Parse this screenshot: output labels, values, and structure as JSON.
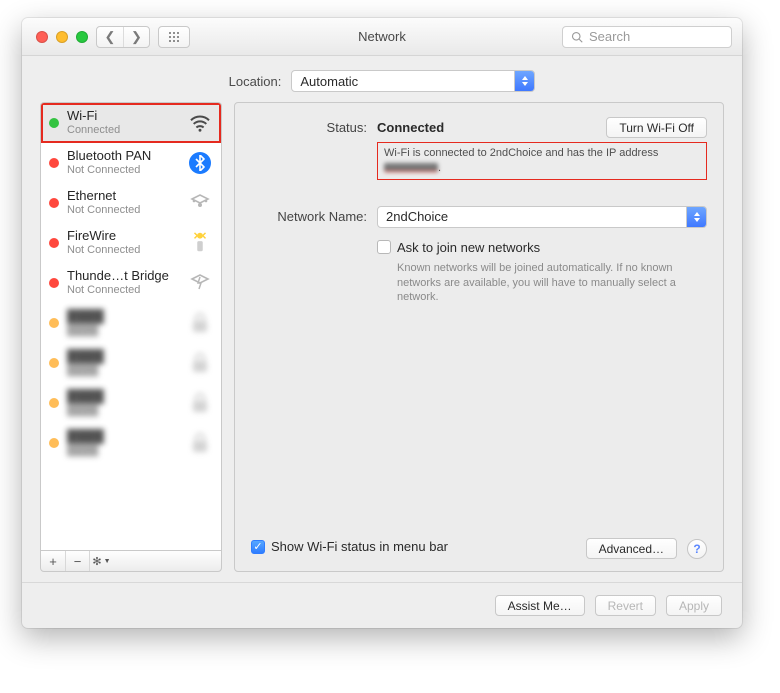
{
  "window": {
    "title": "Network",
    "search_placeholder": "Search"
  },
  "location": {
    "label": "Location:",
    "value": "Automatic"
  },
  "services": [
    {
      "name": "Wi-Fi",
      "sub": "Connected",
      "dot": "green",
      "icon": "wifi",
      "selected": true,
      "highlight": true
    },
    {
      "name": "Bluetooth PAN",
      "sub": "Not Connected",
      "dot": "red",
      "icon": "bluetooth"
    },
    {
      "name": "Ethernet",
      "sub": "Not Connected",
      "dot": "red",
      "icon": "ethernet"
    },
    {
      "name": "FireWire",
      "sub": "Not Connected",
      "dot": "red",
      "icon": "firewire"
    },
    {
      "name": "Thunde…t Bridge",
      "sub": "Not Connected",
      "dot": "red",
      "icon": "thunderbolt"
    },
    {
      "name": "",
      "sub": "",
      "dot": "orange",
      "icon": "lock",
      "blurred": true
    },
    {
      "name": "",
      "sub": "",
      "dot": "orange",
      "icon": "lock",
      "blurred": true
    },
    {
      "name": "",
      "sub": "",
      "dot": "orange",
      "icon": "lock",
      "blurred": true
    },
    {
      "name": "",
      "sub": "",
      "dot": "orange",
      "icon": "lock",
      "blurred": true
    }
  ],
  "sidebar_actions": {
    "add": "+",
    "remove": "−",
    "menu": "✻▾"
  },
  "detail": {
    "status_label": "Status:",
    "status_value": "Connected",
    "wifi_toggle": "Turn Wi-Fi Off",
    "status_desc_prefix": "Wi-Fi is connected to 2ndChoice and has the IP address",
    "network_label": "Network Name:",
    "network_value": "2ndChoice",
    "ask_join": "Ask to join new networks",
    "ask_join_help": "Known networks will be joined automatically. If no known networks are available, you will have to manually select a network.",
    "show_status": "Show Wi-Fi status in menu bar",
    "advanced": "Advanced…",
    "help": "?"
  },
  "footer": {
    "assist": "Assist Me…",
    "revert": "Revert",
    "apply": "Apply"
  }
}
